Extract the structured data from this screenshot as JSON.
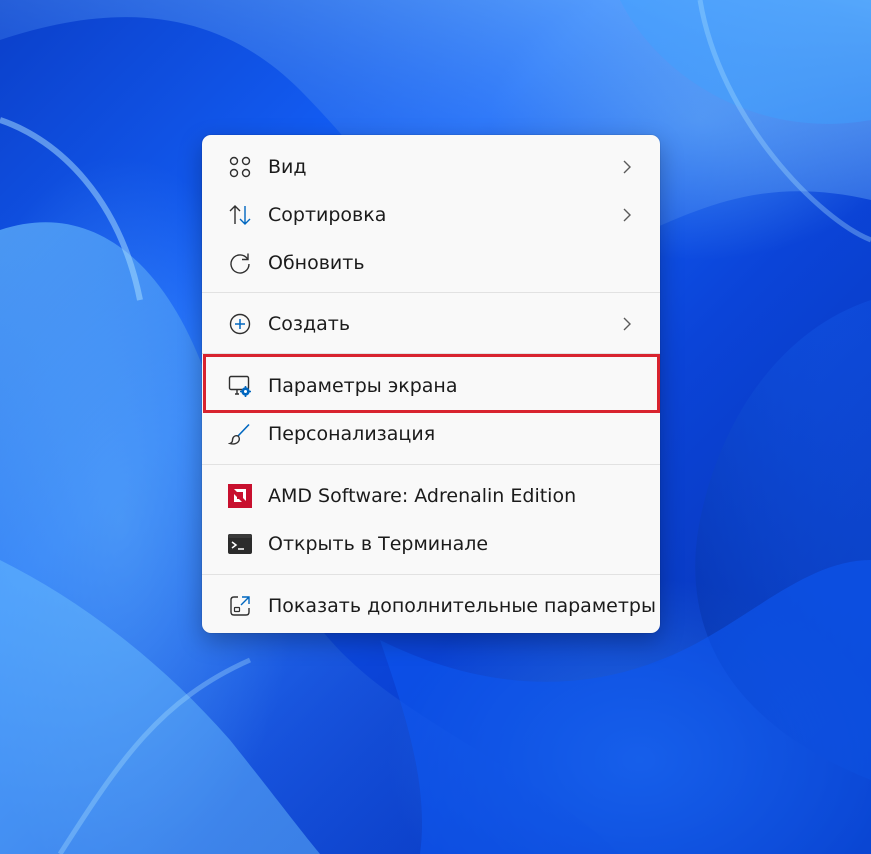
{
  "colors": {
    "accent": "#0067c0",
    "highlight_border": "#d8232f",
    "amd_red": "#c8102e",
    "menu_bg": "#f9f9f9",
    "text": "#1b1b1b"
  },
  "context_menu": {
    "items": [
      {
        "label": "Вид",
        "icon": "grid-icon",
        "has_submenu": true
      },
      {
        "label": "Сортировка",
        "icon": "sort-arrows-icon",
        "has_submenu": true
      },
      {
        "label": "Обновить",
        "icon": "refresh-icon",
        "has_submenu": false
      },
      {
        "label": "Создать",
        "icon": "add-circle-icon",
        "has_submenu": true
      },
      {
        "label": "Параметры экрана",
        "icon": "display-settings-icon",
        "has_submenu": false,
        "highlighted": true
      },
      {
        "label": "Персонализация",
        "icon": "brush-icon",
        "has_submenu": false
      },
      {
        "label": "AMD Software: Adrenalin Edition",
        "icon": "amd-logo-icon",
        "has_submenu": false
      },
      {
        "label": "Открыть в Терминале",
        "icon": "terminal-icon",
        "has_submenu": false
      },
      {
        "label": "Показать дополнительные параметры",
        "icon": "show-more-options-icon",
        "has_submenu": false
      }
    ]
  }
}
